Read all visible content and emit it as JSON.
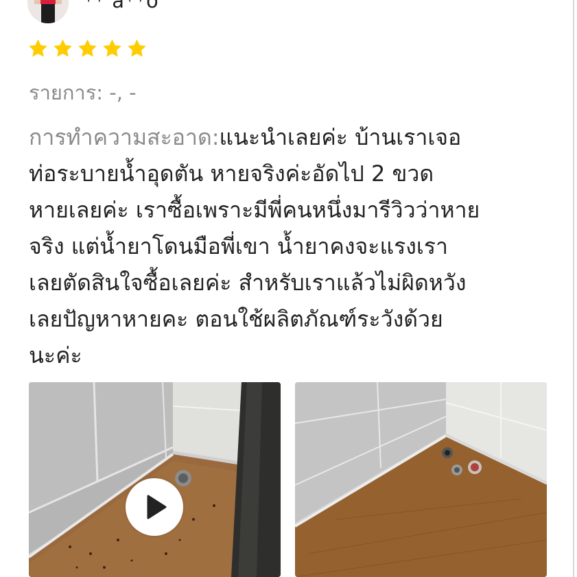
{
  "reviewer": {
    "name": "** a**o",
    "avatar_icon": "avatar-photo"
  },
  "rating": {
    "value": 5,
    "max": 5,
    "star_color": "#FFCC00"
  },
  "item": {
    "label": "รายการ:",
    "value": " -, -"
  },
  "review": {
    "label": "การทำความสะอาด:",
    "lines": [
      "แนะนำเลยค่ะ บ้านเราเจอ",
      "ท่อระบายน้ำอุดตัน หายจริงค่ะอัดไป 2 ขวด",
      "หายเลยค่ะ เราซื้อเพราะมีพี่คนหนึ่งมารีวิวว่าหาย",
      "จริง  แต่น้ำยาโดนมือพี่เขา น้ำยาคงจะแรงเรา",
      "เลยตัดสินใจซื้อเลยค่ะ สำหรับเราแล้วไม่ผิดหวัง",
      "เลยปัญหาหายคะ  ตอนใช้ผลิตภัณฑ์ระวังด้วย",
      "นะค่ะ"
    ]
  },
  "media": [
    {
      "type": "video",
      "icon": "play-icon"
    },
    {
      "type": "image"
    }
  ],
  "colors": {
    "label_gray": "#8A8A8A",
    "text_dark": "#222222"
  }
}
